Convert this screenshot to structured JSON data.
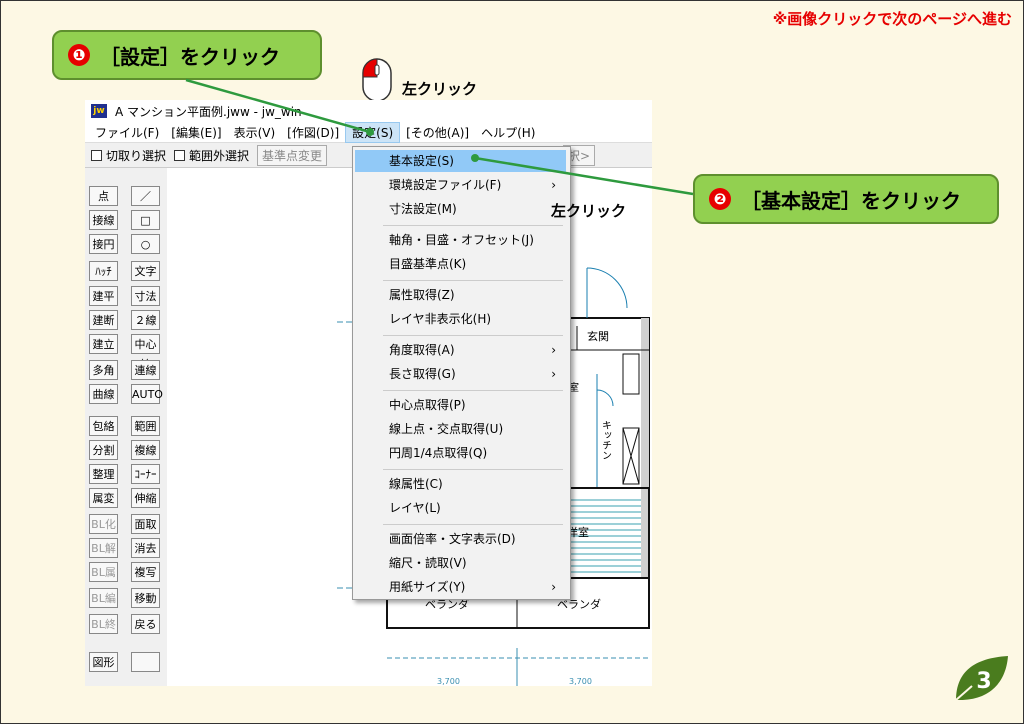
{
  "header_note": "※画像クリックで次のページへ進む",
  "step1": {
    "num": "❶",
    "text": "［設定］をクリック"
  },
  "step2": {
    "num": "❷",
    "text": "［基本設定］をクリック"
  },
  "mouse_label": "左クリック",
  "window": {
    "title": "A マンション平面例.jww - jw_win",
    "menu": [
      "ファイル(F)",
      "[編集(E)]",
      "表示(V)",
      "[作図(D)]",
      "設定(S)",
      "[その他(A)]",
      "ヘルプ(H)"
    ],
    "toolbar": {
      "cut_select": "切取り選択",
      "out_range": "範囲外選択",
      "base_change": "基準点変更",
      "select_tail": "択>"
    }
  },
  "tools_left": [
    "点",
    "接線",
    "接円",
    "ﾊｯﾁ",
    "建平",
    "建断",
    "建立",
    "多角形",
    "曲線",
    "包絡",
    "分割",
    "整理",
    "属変",
    "BL化",
    "BL解",
    "BL属",
    "BL編",
    "BL終",
    "図形"
  ],
  "tools_right": [
    "／",
    "□",
    "○",
    "文字",
    "寸法",
    "２線",
    "中心線",
    "連線",
    "AUTO",
    "範囲",
    "複線",
    "ｺｰﾅｰ",
    "伸縮",
    "面取",
    "消去",
    "複写",
    "移動",
    "戻る",
    ""
  ],
  "dropdown": [
    {
      "label": "基本設定(S)",
      "hl": true
    },
    {
      "label": "環境設定ファイル(F)",
      "arrow": "›"
    },
    {
      "label": "寸法設定(M)"
    },
    {
      "sep": true
    },
    {
      "label": "軸角・目盛・オフセット(J)"
    },
    {
      "label": "目盛基準点(K)"
    },
    {
      "sep": true
    },
    {
      "label": "属性取得(Z)"
    },
    {
      "label": "レイヤ非表示化(H)"
    },
    {
      "sep": true
    },
    {
      "label": "角度取得(A)",
      "arrow": "›"
    },
    {
      "label": "長さ取得(G)",
      "arrow": "›"
    },
    {
      "sep": true
    },
    {
      "label": "中心点取得(P)"
    },
    {
      "label": "線上点・交点取得(U)"
    },
    {
      "label": "円周1/4点取得(Q)"
    },
    {
      "sep": true
    },
    {
      "label": "線属性(C)"
    },
    {
      "label": "レイヤ(L)"
    },
    {
      "sep": true
    },
    {
      "label": "画面倍率・文字表示(D)"
    },
    {
      "label": "縮尺・読取(V)"
    },
    {
      "label": "用紙サイズ(Y)",
      "arrow": "›"
    }
  ],
  "drawing_labels": {
    "genkan": "玄関",
    "kitchen": "キッチン",
    "yoshitsu": "洋室",
    "veranda_left": "ベランダ",
    "veranda_right": "ベランダ",
    "dim_left": "3,700",
    "dim_right": "3,700",
    "misc": "室"
  },
  "page_number": "3",
  "colors": {
    "callout": "#92d050",
    "note_red": "#e60000",
    "highlight": "#91c9f7",
    "leaf": "#4a7c1e"
  }
}
